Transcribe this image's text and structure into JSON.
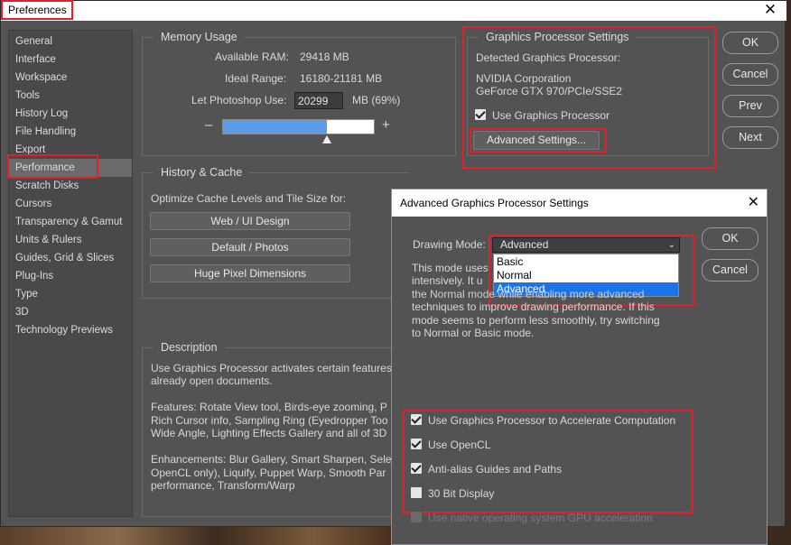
{
  "window": {
    "title": "Preferences",
    "close_glyph": "✕"
  },
  "sidebar": {
    "items": [
      {
        "label": "General"
      },
      {
        "label": "Interface"
      },
      {
        "label": "Workspace"
      },
      {
        "label": "Tools"
      },
      {
        "label": "History Log"
      },
      {
        "label": "File Handling"
      },
      {
        "label": "Export"
      },
      {
        "label": "Performance"
      },
      {
        "label": "Scratch Disks"
      },
      {
        "label": "Cursors"
      },
      {
        "label": "Transparency & Gamut"
      },
      {
        "label": "Units & Rulers"
      },
      {
        "label": "Guides, Grid & Slices"
      },
      {
        "label": "Plug-Ins"
      },
      {
        "label": "Type"
      },
      {
        "label": "3D"
      },
      {
        "label": "Technology Previews"
      }
    ],
    "active": "Performance"
  },
  "memory": {
    "title": "Memory Usage",
    "available_label": "Available RAM:",
    "available_value": "29418 MB",
    "ideal_label": "Ideal Range:",
    "ideal_value": "16180-21181 MB",
    "let_label": "Let Photoshop Use:",
    "let_value": "20299",
    "let_suffix": "MB (69%)",
    "slider_fraction": 0.69,
    "minus": "–",
    "plus": "+"
  },
  "gpu": {
    "title": "Graphics Processor Settings",
    "detected_label": "Detected Graphics Processor:",
    "vendor": "NVIDIA Corporation",
    "model": "GeForce GTX 970/PCIe/SSE2",
    "use_gpu_label": "Use Graphics Processor",
    "use_gpu_checked": true,
    "advanced_button": "Advanced Settings..."
  },
  "buttons": {
    "ok": "OK",
    "cancel": "Cancel",
    "prev": "Prev",
    "next": "Next"
  },
  "cache": {
    "title": "History & Cache",
    "optimize_label": "Optimize Cache Levels and Tile Size for:",
    "presets": [
      "Web / UI Design",
      "Default / Photos",
      "Huge Pixel Dimensions"
    ]
  },
  "description": {
    "title": "Description",
    "p1a": "Use Graphics Processor activates certain features",
    "p1b": "already open documents.",
    "p2a": "Features: Rotate View tool, Birds-eye zooming, P",
    "p2b": "Rich Cursor info, Sampling Ring (Eyedropper Too",
    "p2c": "Wide Angle, Lighting Effects Gallery and all of 3D",
    "p3a": "Enhancements: Blur Gallery, Smart Sharpen, Sele",
    "p3b": "OpenCL only), Liquify, Puppet Warp, Smooth Par",
    "p3c": "performance, Transform/Warp"
  },
  "advanced": {
    "title": "Advanced Graphics Processor Settings",
    "close_glyph": "✕",
    "mode_label": "Drawing Mode:",
    "mode_value": "Advanced",
    "mode_options": [
      "Basic",
      "Normal",
      "Advanced"
    ],
    "mode_desc_1": "This mode uses",
    "mode_desc_2": "intensively.  It u",
    "mode_desc_3": "the Normal mode while enabling more advanced",
    "mode_desc_4": "techniques to improve drawing performance.  If this",
    "mode_desc_5": "mode seems to perform less smoothly, try switching",
    "mode_desc_6": "to Normal or Basic mode.",
    "ok": "OK",
    "cancel": "Cancel",
    "options": [
      {
        "label": "Use Graphics Processor to Accelerate Computation",
        "checked": true
      },
      {
        "label": "Use OpenCL",
        "checked": true
      },
      {
        "label": "Anti-alias Guides and Paths",
        "checked": true
      },
      {
        "label": "30 Bit Display",
        "checked": false
      }
    ],
    "native_label": "Use native operating system GPU acceleration"
  },
  "colors": {
    "highlight_red": "#e0202a",
    "selection_blue": "#1a73e8",
    "slider_fill": "#5b9bea"
  }
}
